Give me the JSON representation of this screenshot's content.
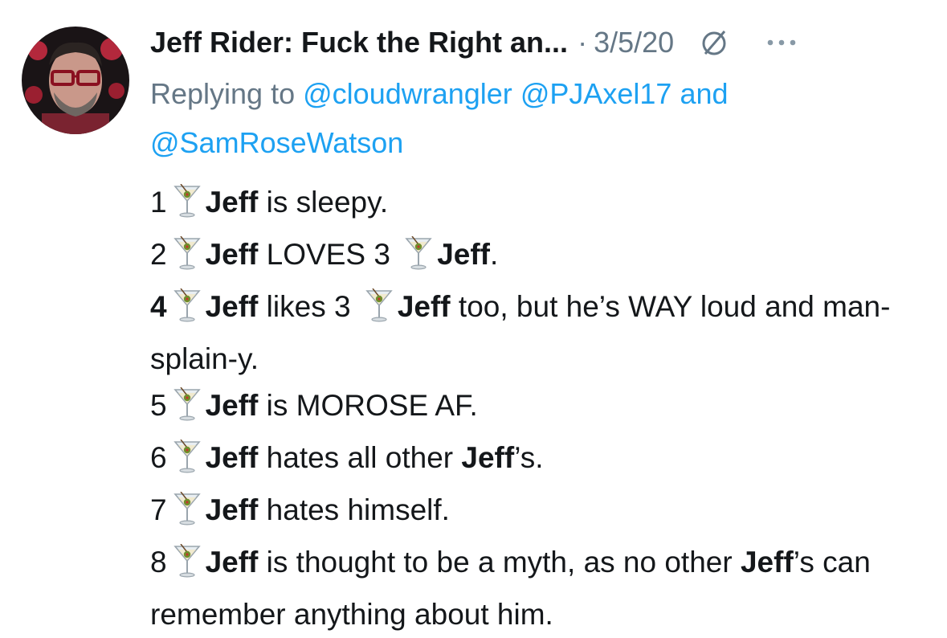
{
  "author": {
    "display_name": "Jeff Rider: Fuck the Right an...",
    "separator": "·",
    "date": "3/5/20"
  },
  "reply": {
    "prefix": "Replying to",
    "mentions": [
      "@cloudwrangler",
      "@PJAxel17",
      "@SamRoseWatson"
    ],
    "and": "and"
  },
  "icons": {
    "nosign": "no-entry-sign-icon",
    "more": "more-dots-icon",
    "martini": "cocktail-glass-emoji"
  },
  "colors": {
    "text": "#14171a",
    "secondary": "#657786",
    "link": "#1da1f2"
  },
  "tweet": {
    "lines": [
      {
        "num": "1",
        "parts": [
          {
            "b": "Jeff"
          },
          {
            "t": " is sleepy."
          }
        ]
      },
      {
        "num": "2",
        "parts": [
          {
            "b": "Jeff"
          },
          {
            "t": " LOVES 3 "
          },
          {
            "m": "🍸"
          },
          {
            "b": "Jeff"
          },
          {
            "t": "."
          }
        ]
      },
      {
        "num": "4",
        "num_bold": true,
        "parts": [
          {
            "b": "Jeff"
          },
          {
            "t": " likes 3 "
          },
          {
            "m": "🍸"
          },
          {
            "b": "Jeff"
          },
          {
            "t": " too, but he’s WAY loud and man-splain-y."
          }
        ]
      },
      {
        "num": "5",
        "parts": [
          {
            "b": "Jeff"
          },
          {
            "t": " is MOROSE AF."
          }
        ]
      },
      {
        "num": "6",
        "parts": [
          {
            "b": "Jeff"
          },
          {
            "t": " hates all other "
          },
          {
            "b": "Jeff"
          },
          {
            "t": "’s."
          }
        ]
      },
      {
        "num": "7",
        "parts": [
          {
            "b": "Jeff"
          },
          {
            "t": " hates himself."
          }
        ]
      },
      {
        "num": "8",
        "parts": [
          {
            "b": "Jeff"
          },
          {
            "t": " is thought to be a myth, as no other "
          },
          {
            "b": "Jeff"
          },
          {
            "t": "’s can remember anything about him."
          }
        ]
      }
    ]
  }
}
